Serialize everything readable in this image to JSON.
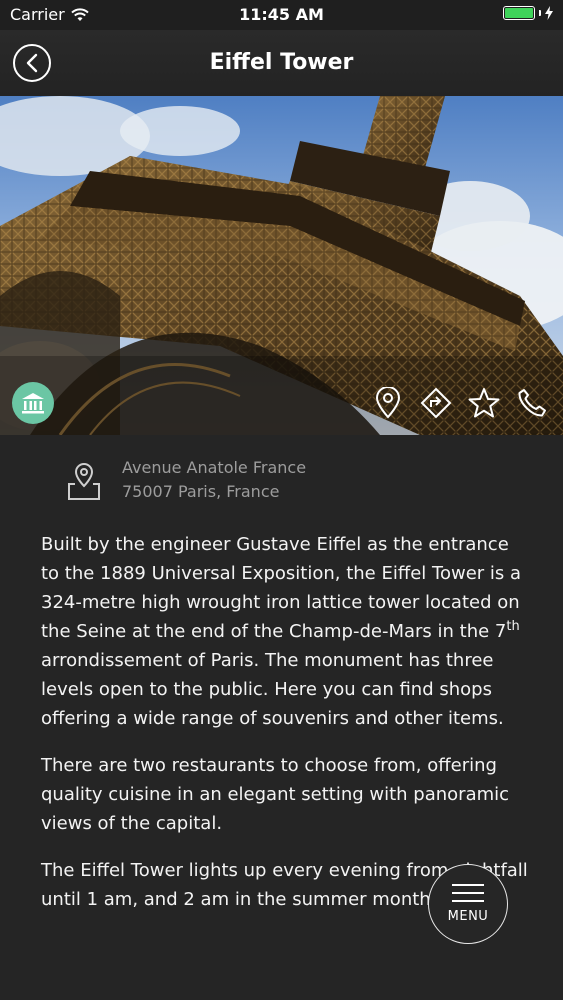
{
  "status_bar": {
    "carrier": "Carrier",
    "time": "11:45 AM",
    "battery_level": 1.0,
    "battery_color": "#3fd45a"
  },
  "header": {
    "title": "Eiffel Tower",
    "back_icon": "chevron-left-circle-icon"
  },
  "hero": {
    "category_icon": "museum-icon",
    "category_color": "#6bc6a4",
    "actions": [
      "map-pin-icon",
      "directions-icon",
      "star-icon",
      "phone-icon"
    ]
  },
  "address": {
    "line1": "Avenue Anatole France",
    "line2": "75007 Paris, France"
  },
  "description": {
    "p1_a": "Built by the engineer Gustave Eiffel as the entrance to the 1889 Universal Exposition, the Eiffel Tower is a 324-metre high wrought iron lattice tower located on the Seine at the end of the Champ-de-Mars in the 7",
    "p1_sup": "th",
    "p1_b": " arrondissement of Paris. The monument has three levels open to the public. Here you can find shops offering a wide range of souvenirs and other items.",
    "p2": "There are two restaurants to choose from, offering quality cuisine in an elegant setting with panoramic views of the capital.",
    "p3": "The Eiffel Tower lights up every evening from nightfall until 1 am, and 2 am in the summer months."
  },
  "menu": {
    "label": "MENU"
  }
}
